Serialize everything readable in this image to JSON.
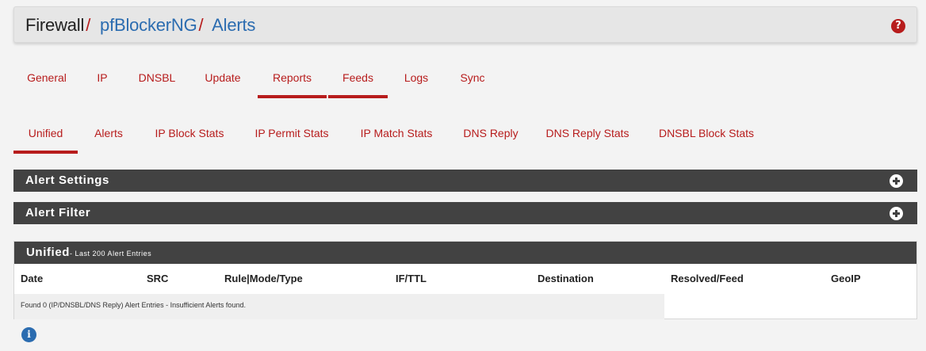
{
  "breadcrumb": {
    "root": "Firewall",
    "sep": "/",
    "items": [
      "pfBlockerNG",
      "Alerts"
    ]
  },
  "icons": {
    "help": "question-circle-icon",
    "expand": "plus-circle-icon",
    "info": "info-circle-icon"
  },
  "primary_tabs": [
    "General",
    "IP",
    "DNSBL",
    "Update",
    "Reports",
    "Feeds",
    "Logs",
    "Sync"
  ],
  "secondary_tabs": [
    "Unified",
    "Alerts",
    "IP Block Stats",
    "IP Permit Stats",
    "IP Match Stats",
    "DNS Reply",
    "DNS Reply Stats",
    "DNSBL Block Stats"
  ],
  "panels": {
    "alert_settings": "Alert Settings",
    "alert_filter": "Alert Filter"
  },
  "unified": {
    "title": "Unified",
    "subtitle": "- Last 200 Alert Entries",
    "columns": [
      "Date",
      "SRC",
      "Rule|Mode/Type",
      "IF/TTL",
      "Destination",
      "Resolved/Feed",
      "GeoIP"
    ],
    "empty_message": "Found 0 (IP/DNSBL/DNS Reply) Alert Entries - Insufficient Alerts found."
  },
  "colors": {
    "accent": "#b71c1c",
    "link": "#2b6cb0",
    "panel": "#424242"
  }
}
